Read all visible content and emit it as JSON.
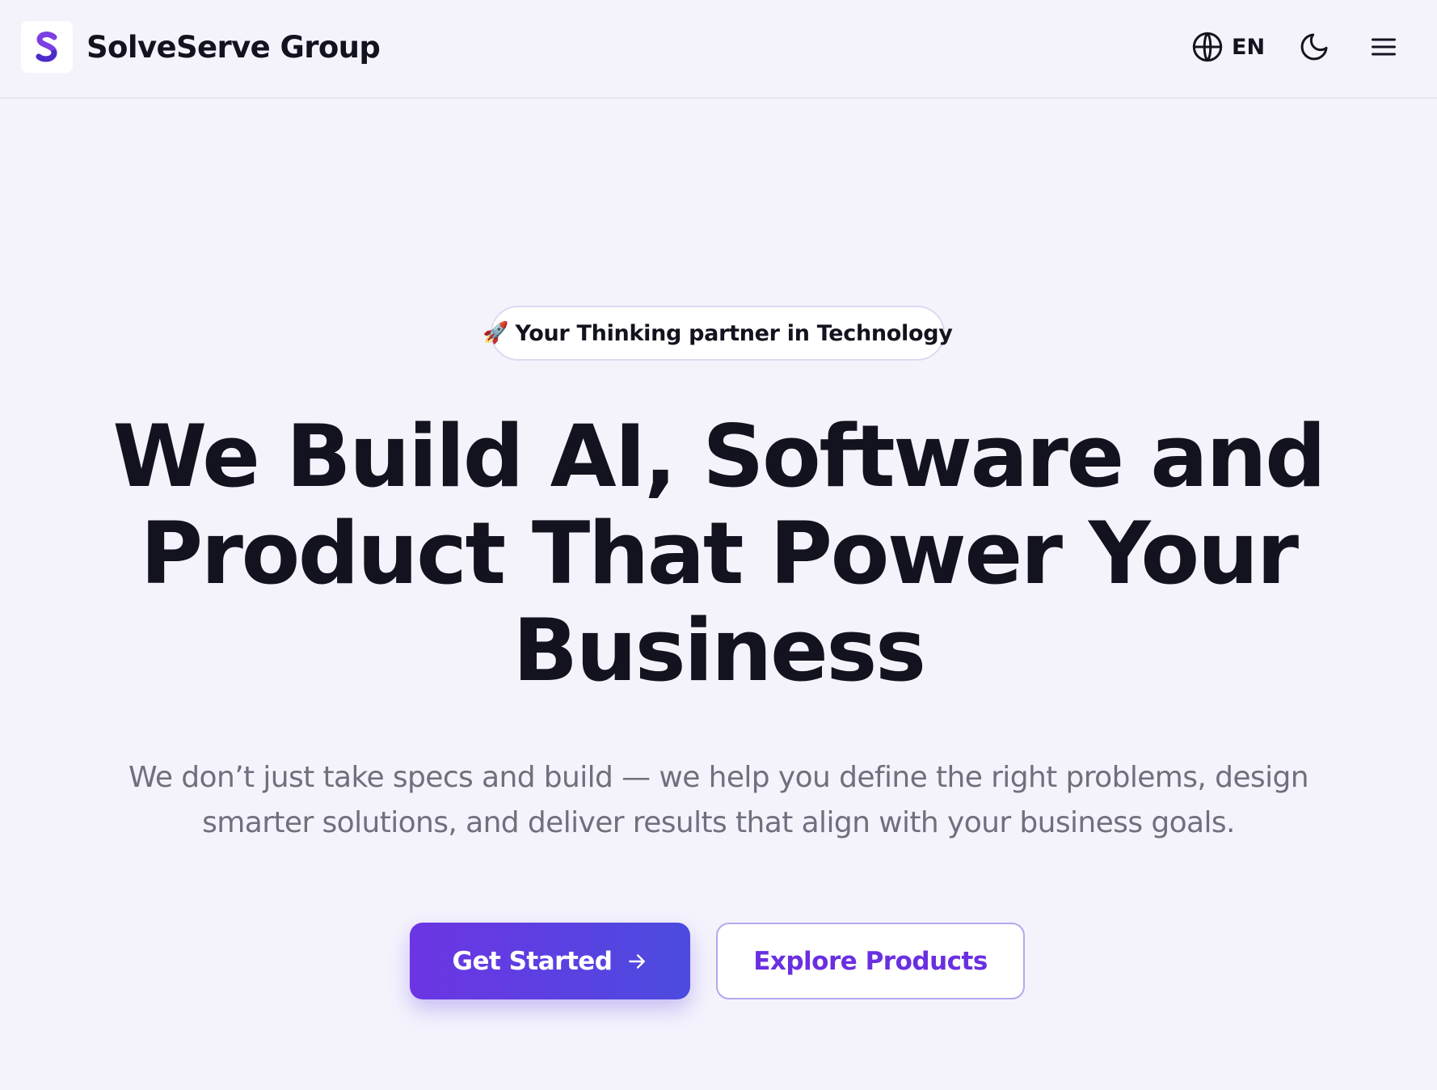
{
  "header": {
    "brand_name": "SolveServe Group",
    "language_label": "EN",
    "icons": {
      "logo": "solveserve-logo",
      "language": "globe-icon",
      "theme": "moon-icon",
      "menu": "hamburger-menu-icon"
    }
  },
  "hero": {
    "badge_emoji": "🚀",
    "badge_text": "Your Thinking partner in Technology",
    "title": "We Build AI, Software and Product That Power Your Business",
    "subtitle": "We don’t just take specs and build — we help you define the right problems, design smarter solutions, and deliver results that align with your business goals.",
    "primary_button": "Get Started",
    "secondary_button": "Explore Products"
  },
  "colors": {
    "background": "#f4f3fc",
    "accent": "#6a2fe0",
    "accent_gradient_end": "#4c4bdf",
    "heading_text": "#13131f",
    "muted_text": "#6f6f7d"
  }
}
